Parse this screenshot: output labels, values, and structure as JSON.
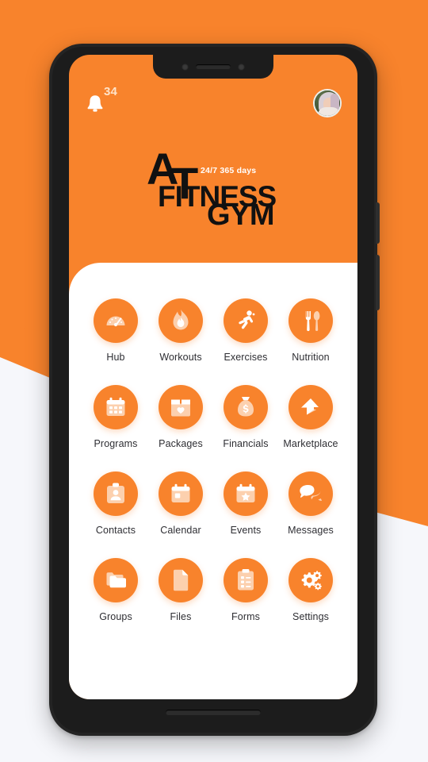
{
  "background": {
    "page_color": "#f6f7fb",
    "accent_color": "#F8832C"
  },
  "device": {
    "frame_color": "#242424",
    "buttons": [
      "power-button",
      "volume-button"
    ],
    "notch": "camera-notch"
  },
  "statusbar": {
    "notifications": {
      "icon": "bell-icon",
      "badge_count": "34"
    },
    "avatar": {
      "icon": "user-avatar",
      "label": ""
    }
  },
  "logo": {
    "letter_a": "A",
    "letter_t": "T",
    "word_fitness": "FITNESS",
    "word_gym": "GYM",
    "tagline": "24/7 365 days"
  },
  "menu": {
    "items": [
      {
        "label": "Hub",
        "icon": "gauge-icon"
      },
      {
        "label": "Workouts",
        "icon": "flame-icon"
      },
      {
        "label": "Exercises",
        "icon": "running-icon"
      },
      {
        "label": "Nutrition",
        "icon": "cutlery-icon"
      },
      {
        "label": "Programs",
        "icon": "calendar-grid-icon"
      },
      {
        "label": "Packages",
        "icon": "box-heart-icon"
      },
      {
        "label": "Financials",
        "icon": "money-bag-icon"
      },
      {
        "label": "Marketplace",
        "icon": "marketplace-arrow-icon"
      },
      {
        "label": "Contacts",
        "icon": "id-badge-icon"
      },
      {
        "label": "Calendar",
        "icon": "calendar-icon"
      },
      {
        "label": "Events",
        "icon": "calendar-star-icon"
      },
      {
        "label": "Messages",
        "icon": "chat-bubbles-icon"
      },
      {
        "label": "Groups",
        "icon": "folders-icon"
      },
      {
        "label": "Files",
        "icon": "document-icon"
      },
      {
        "label": "Forms",
        "icon": "clipboard-check-icon"
      },
      {
        "label": "Settings",
        "icon": "gears-icon"
      }
    ]
  }
}
